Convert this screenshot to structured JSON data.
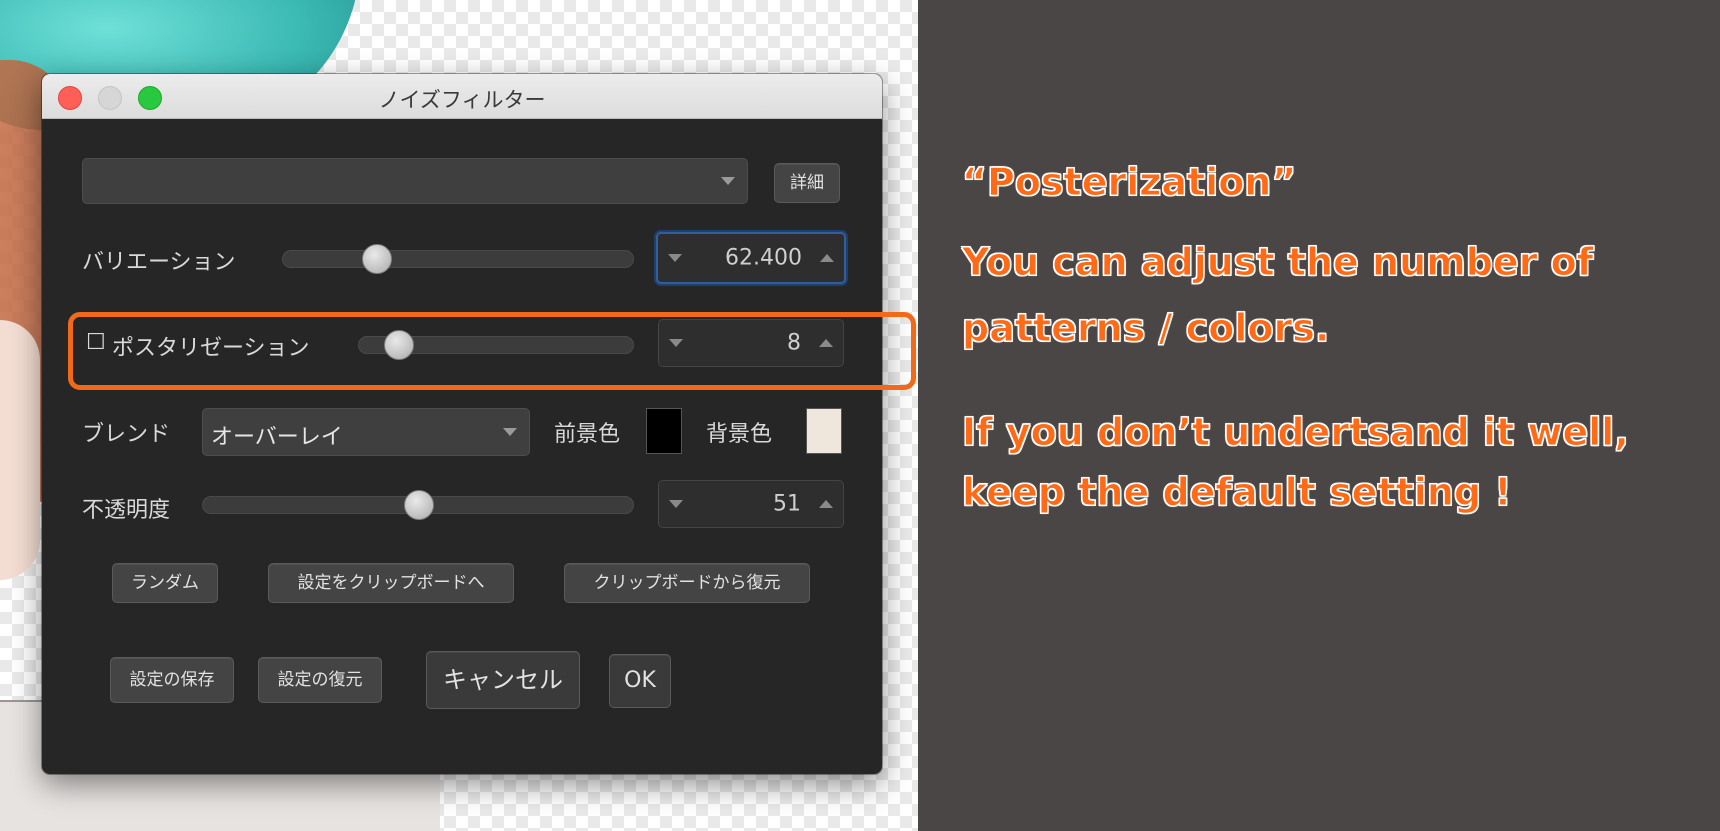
{
  "window": {
    "title": "ノイズフィルター"
  },
  "preset": {
    "selected": "",
    "details_button": "詳細"
  },
  "variation": {
    "label": "バリエーション",
    "slider_fraction": 0.27,
    "value": "62.400"
  },
  "posterization": {
    "checkbox": "☐",
    "label": "ポスタリゼーション",
    "slider_fraction": 0.12,
    "value": "8"
  },
  "blend": {
    "label": "ブレンド",
    "mode": "オーバーレイ",
    "foreground_label": "前景色",
    "foreground_color": "#000000",
    "background_label": "背景色",
    "background_color": "#efe6dc"
  },
  "opacity": {
    "label": "不透明度",
    "slider_fraction": 0.5,
    "value": "51"
  },
  "buttons": {
    "random": "ランダム",
    "copy_to_clipboard": "設定をクリップボードへ",
    "restore_from_clipboard": "クリップボードから復元",
    "save_settings": "設定の保存",
    "restore_settings": "設定の復元",
    "cancel": "キャンセル",
    "ok": "OK"
  },
  "annotation": {
    "title": "“Posterization”",
    "line1": "You can adjust the number of",
    "line2": "patterns / colors.",
    "line3": "If you don’t undertsand it well,",
    "line4": "keep the default setting !",
    "highlight_color": "#f06a1a"
  }
}
